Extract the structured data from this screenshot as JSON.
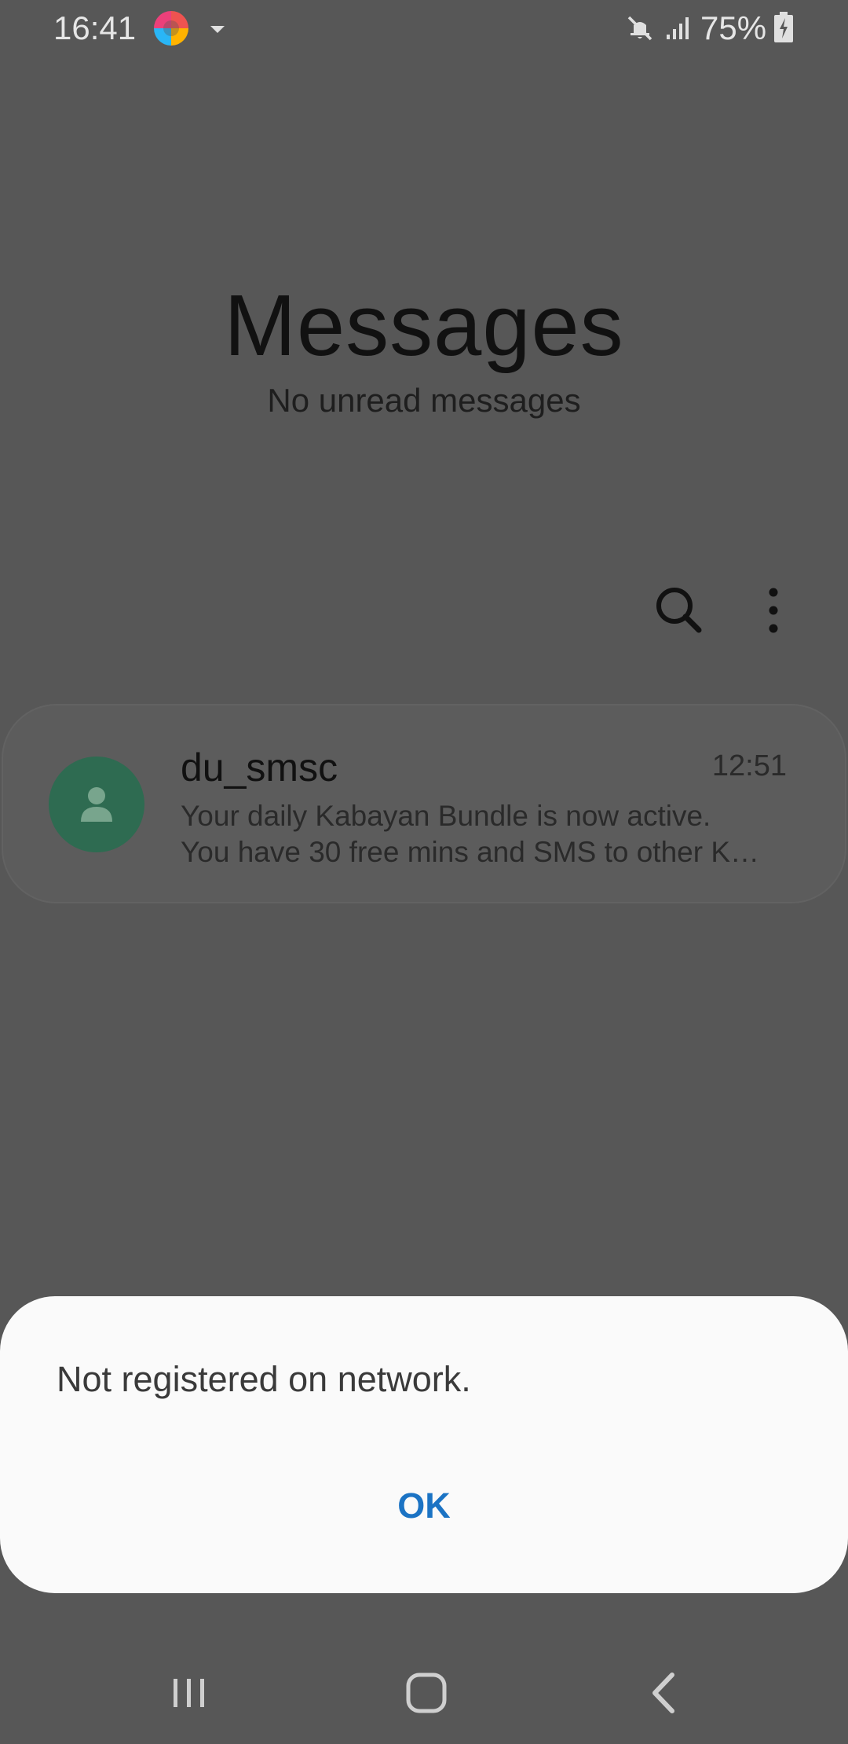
{
  "status_bar": {
    "time": "16:41",
    "battery": "75%",
    "icons": [
      "app-logo-icon",
      "dropdown-icon",
      "mute-icon",
      "signal-icon",
      "battery-charging-icon"
    ]
  },
  "header": {
    "title": "Messages",
    "subtitle": "No unread messages"
  },
  "toolbar": {
    "icons": [
      "search-icon",
      "more-options-icon"
    ]
  },
  "conversations": [
    {
      "sender": "du_smsc",
      "time": "12:51",
      "preview_line1": "Your daily Kabayan Bundle is now active.",
      "preview_line2": "You have 30 free mins and SMS to other K…"
    }
  ],
  "dialog": {
    "message": "Not registered on network.",
    "ok_label": "OK"
  },
  "nav_bar": {
    "icons": [
      "recents-icon",
      "home-icon",
      "back-icon"
    ]
  },
  "colors": {
    "background_dimmed": "#575757",
    "dialog_background": "#fafafa",
    "accent": "#1b73c4",
    "avatar": "#2e6b51"
  }
}
